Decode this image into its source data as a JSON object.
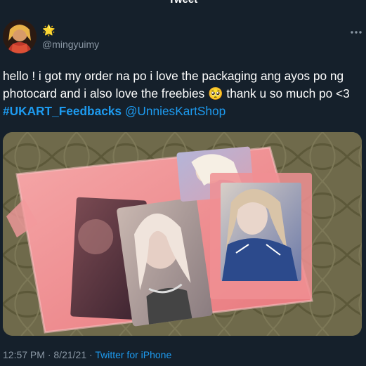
{
  "header": {
    "title": "Tweet"
  },
  "author": {
    "display_name": "🌟",
    "handle": "@mingyuimy",
    "avatar_icon": "profile-avatar-icon"
  },
  "tweet": {
    "text_before": "hello ! i got my order na po i love the packaging ang ayos po ng photocard and i also love the freebies ",
    "emoji": "🥺",
    "text_middle": " thank u so much po <3 ",
    "hashtag": "#UKART_Feedbacks",
    "space": " ",
    "mention": "@UnniesKartShop",
    "image_description_icon": "photo-of-photocards-and-pink-packaging"
  },
  "meta": {
    "time": "12:57 PM",
    "separator1": " · ",
    "date": "8/21/21",
    "separator2": " · ",
    "source": "Twitter for iPhone"
  },
  "colors": {
    "background": "#15202b",
    "accent": "#1d9bf0",
    "secondary_text": "#8b98a5"
  }
}
